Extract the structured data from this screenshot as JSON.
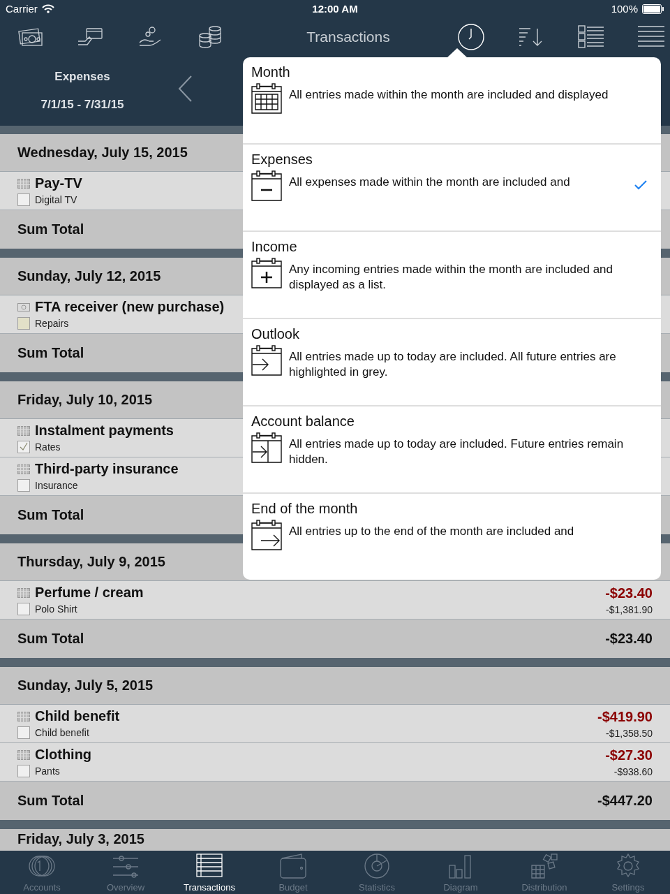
{
  "status_bar": {
    "carrier": "Carrier",
    "time": "12:00 AM",
    "battery": "100%"
  },
  "nav_bar": {
    "title": "Transactions",
    "right_icons": [
      {
        "kind": "clock",
        "selected": true
      },
      {
        "kind": "sort",
        "selected": false
      },
      {
        "kind": "gallery",
        "selected": false
      },
      {
        "kind": "menu",
        "selected": false
      }
    ]
  },
  "period": {
    "label": "Expenses",
    "range": "7/1/15 - 7/31/15"
  },
  "days": [
    {
      "date": "Wednesday, July 15, 2015",
      "entries": [
        {
          "kind": "grid",
          "title": "Pay-TV",
          "category": "Digital TV",
          "checked": false,
          "color": "#f0f0f0"
        }
      ],
      "sum_label": "Sum Total"
    },
    {
      "date": "Sunday, July 12, 2015",
      "entries": [
        {
          "kind": "cash",
          "title": "FTA receiver (new purchase)",
          "category": "Repairs",
          "checked": false,
          "color": "#e2e0c8"
        }
      ],
      "sum_label": "Sum Total"
    },
    {
      "date": "Friday, July 10, 2015",
      "entries": [
        {
          "kind": "grid",
          "title": "Instalment payments",
          "category": "Rates",
          "checked": true,
          "color": "#f0f0f0"
        },
        {
          "kind": "grid",
          "title": "Third-party insurance",
          "category": "Insurance",
          "checked": false,
          "color": "#f0f0f0"
        }
      ],
      "sum_label": "Sum Total"
    },
    {
      "date": "Thursday, July 9, 2015",
      "entries": [
        {
          "kind": "grid",
          "title": "Perfume / cream",
          "category": "Polo Shirt",
          "checked": false,
          "color": "#f0f0f0",
          "amount": "-$23.40",
          "balance": "-$1,381.90"
        }
      ],
      "sum_label": "Sum Total",
      "sum": "-$23.40"
    },
    {
      "date": "Sunday, July 5, 2015",
      "entries": [
        {
          "kind": "grid",
          "title": "Child benefit",
          "category": "Child benefit",
          "checked": false,
          "color": "#f0f0f0",
          "amount": "-$419.90",
          "balance": "-$1,358.50"
        },
        {
          "kind": "grid",
          "title": "Clothing",
          "category": "Pants",
          "checked": false,
          "color": "#f0f0f0",
          "amount": "-$27.30",
          "balance": "-$938.60"
        }
      ],
      "sum_label": "Sum Total",
      "sum": "-$447.20"
    },
    {
      "date": "Friday, July 3, 2015"
    }
  ],
  "filter_popover": {
    "options": [
      {
        "kind": "month",
        "title": "Month",
        "description": "All entries made within the month are included and displayed",
        "selected": false
      },
      {
        "kind": "minus",
        "title": "Expenses",
        "description": "All expenses made within the month are included and",
        "selected": true
      },
      {
        "kind": "plus",
        "title": "Income",
        "description": "Any incoming entries made within the month are included and displayed as a list.",
        "selected": false
      },
      {
        "kind": "arrow",
        "title": "Outlook",
        "description": "All entries made up to today are included. All future entries are highlighted in grey.",
        "selected": false
      },
      {
        "kind": "split",
        "title": "Account balance",
        "description": "All entries made up to today are included. Future entries remain hidden.",
        "selected": false
      },
      {
        "kind": "end",
        "title": "End of the month",
        "description": "All entries up to the end of the month are included and",
        "selected": false
      }
    ]
  },
  "tab_bar": [
    {
      "kind": "accounts",
      "label": "Accounts",
      "selected": false
    },
    {
      "kind": "overview",
      "label": "Overview",
      "selected": false
    },
    {
      "kind": "transactions",
      "label": "Transactions",
      "selected": true
    },
    {
      "kind": "budget",
      "label": "Budget",
      "selected": false
    },
    {
      "kind": "statistics",
      "label": "Statistics",
      "selected": false
    },
    {
      "kind": "diagram",
      "label": "Diagram",
      "selected": false
    },
    {
      "kind": "distribution",
      "label": "Distribution",
      "selected": false
    },
    {
      "kind": "settings",
      "label": "Settings",
      "selected": false
    }
  ]
}
